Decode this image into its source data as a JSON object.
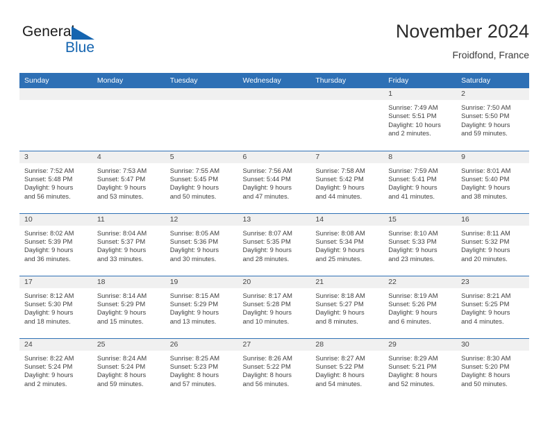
{
  "brand": {
    "name_part1": "General",
    "name_part2": "Blue",
    "color_blue": "#1565b0"
  },
  "header": {
    "title": "November 2024",
    "subtitle": "Froidfond, France"
  },
  "theme": {
    "header_blue": "#2e70b5",
    "daynum_band": "#f0f0f0"
  },
  "columns": [
    "Sunday",
    "Monday",
    "Tuesday",
    "Wednesday",
    "Thursday",
    "Friday",
    "Saturday"
  ],
  "weeks": [
    [
      {
        "day": "",
        "lines": []
      },
      {
        "day": "",
        "lines": []
      },
      {
        "day": "",
        "lines": []
      },
      {
        "day": "",
        "lines": []
      },
      {
        "day": "",
        "lines": []
      },
      {
        "day": "1",
        "lines": [
          "Sunrise: 7:49 AM",
          "Sunset: 5:51 PM",
          "Daylight: 10 hours",
          "and 2 minutes."
        ]
      },
      {
        "day": "2",
        "lines": [
          "Sunrise: 7:50 AM",
          "Sunset: 5:50 PM",
          "Daylight: 9 hours",
          "and 59 minutes."
        ]
      }
    ],
    [
      {
        "day": "3",
        "lines": [
          "Sunrise: 7:52 AM",
          "Sunset: 5:48 PM",
          "Daylight: 9 hours",
          "and 56 minutes."
        ]
      },
      {
        "day": "4",
        "lines": [
          "Sunrise: 7:53 AM",
          "Sunset: 5:47 PM",
          "Daylight: 9 hours",
          "and 53 minutes."
        ]
      },
      {
        "day": "5",
        "lines": [
          "Sunrise: 7:55 AM",
          "Sunset: 5:45 PM",
          "Daylight: 9 hours",
          "and 50 minutes."
        ]
      },
      {
        "day": "6",
        "lines": [
          "Sunrise: 7:56 AM",
          "Sunset: 5:44 PM",
          "Daylight: 9 hours",
          "and 47 minutes."
        ]
      },
      {
        "day": "7",
        "lines": [
          "Sunrise: 7:58 AM",
          "Sunset: 5:42 PM",
          "Daylight: 9 hours",
          "and 44 minutes."
        ]
      },
      {
        "day": "8",
        "lines": [
          "Sunrise: 7:59 AM",
          "Sunset: 5:41 PM",
          "Daylight: 9 hours",
          "and 41 minutes."
        ]
      },
      {
        "day": "9",
        "lines": [
          "Sunrise: 8:01 AM",
          "Sunset: 5:40 PM",
          "Daylight: 9 hours",
          "and 38 minutes."
        ]
      }
    ],
    [
      {
        "day": "10",
        "lines": [
          "Sunrise: 8:02 AM",
          "Sunset: 5:39 PM",
          "Daylight: 9 hours",
          "and 36 minutes."
        ]
      },
      {
        "day": "11",
        "lines": [
          "Sunrise: 8:04 AM",
          "Sunset: 5:37 PM",
          "Daylight: 9 hours",
          "and 33 minutes."
        ]
      },
      {
        "day": "12",
        "lines": [
          "Sunrise: 8:05 AM",
          "Sunset: 5:36 PM",
          "Daylight: 9 hours",
          "and 30 minutes."
        ]
      },
      {
        "day": "13",
        "lines": [
          "Sunrise: 8:07 AM",
          "Sunset: 5:35 PM",
          "Daylight: 9 hours",
          "and 28 minutes."
        ]
      },
      {
        "day": "14",
        "lines": [
          "Sunrise: 8:08 AM",
          "Sunset: 5:34 PM",
          "Daylight: 9 hours",
          "and 25 minutes."
        ]
      },
      {
        "day": "15",
        "lines": [
          "Sunrise: 8:10 AM",
          "Sunset: 5:33 PM",
          "Daylight: 9 hours",
          "and 23 minutes."
        ]
      },
      {
        "day": "16",
        "lines": [
          "Sunrise: 8:11 AM",
          "Sunset: 5:32 PM",
          "Daylight: 9 hours",
          "and 20 minutes."
        ]
      }
    ],
    [
      {
        "day": "17",
        "lines": [
          "Sunrise: 8:12 AM",
          "Sunset: 5:30 PM",
          "Daylight: 9 hours",
          "and 18 minutes."
        ]
      },
      {
        "day": "18",
        "lines": [
          "Sunrise: 8:14 AM",
          "Sunset: 5:29 PM",
          "Daylight: 9 hours",
          "and 15 minutes."
        ]
      },
      {
        "day": "19",
        "lines": [
          "Sunrise: 8:15 AM",
          "Sunset: 5:29 PM",
          "Daylight: 9 hours",
          "and 13 minutes."
        ]
      },
      {
        "day": "20",
        "lines": [
          "Sunrise: 8:17 AM",
          "Sunset: 5:28 PM",
          "Daylight: 9 hours",
          "and 10 minutes."
        ]
      },
      {
        "day": "21",
        "lines": [
          "Sunrise: 8:18 AM",
          "Sunset: 5:27 PM",
          "Daylight: 9 hours",
          "and 8 minutes."
        ]
      },
      {
        "day": "22",
        "lines": [
          "Sunrise: 8:19 AM",
          "Sunset: 5:26 PM",
          "Daylight: 9 hours",
          "and 6 minutes."
        ]
      },
      {
        "day": "23",
        "lines": [
          "Sunrise: 8:21 AM",
          "Sunset: 5:25 PM",
          "Daylight: 9 hours",
          "and 4 minutes."
        ]
      }
    ],
    [
      {
        "day": "24",
        "lines": [
          "Sunrise: 8:22 AM",
          "Sunset: 5:24 PM",
          "Daylight: 9 hours",
          "and 2 minutes."
        ]
      },
      {
        "day": "25",
        "lines": [
          "Sunrise: 8:24 AM",
          "Sunset: 5:24 PM",
          "Daylight: 8 hours",
          "and 59 minutes."
        ]
      },
      {
        "day": "26",
        "lines": [
          "Sunrise: 8:25 AM",
          "Sunset: 5:23 PM",
          "Daylight: 8 hours",
          "and 57 minutes."
        ]
      },
      {
        "day": "27",
        "lines": [
          "Sunrise: 8:26 AM",
          "Sunset: 5:22 PM",
          "Daylight: 8 hours",
          "and 56 minutes."
        ]
      },
      {
        "day": "28",
        "lines": [
          "Sunrise: 8:27 AM",
          "Sunset: 5:22 PM",
          "Daylight: 8 hours",
          "and 54 minutes."
        ]
      },
      {
        "day": "29",
        "lines": [
          "Sunrise: 8:29 AM",
          "Sunset: 5:21 PM",
          "Daylight: 8 hours",
          "and 52 minutes."
        ]
      },
      {
        "day": "30",
        "lines": [
          "Sunrise: 8:30 AM",
          "Sunset: 5:20 PM",
          "Daylight: 8 hours",
          "and 50 minutes."
        ]
      }
    ]
  ]
}
